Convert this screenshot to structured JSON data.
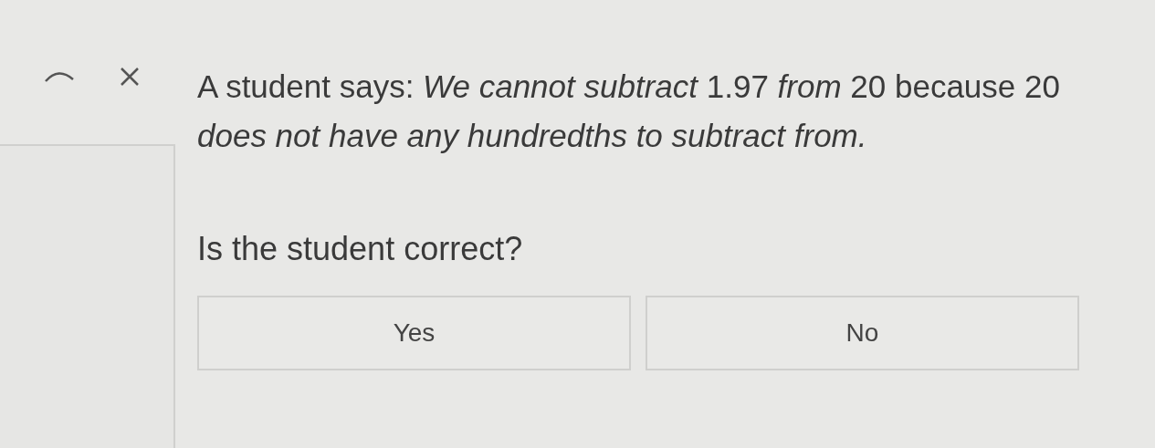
{
  "prompt": "A student says: *We cannot subtract* 1.97 *from* 20 because 20 *does not have any hundredths to subtract from.*",
  "question": "Is the student correct?",
  "choices": [
    {
      "label": "Yes",
      "selected": false
    },
    {
      "label": "No",
      "selected": false
    }
  ]
}
